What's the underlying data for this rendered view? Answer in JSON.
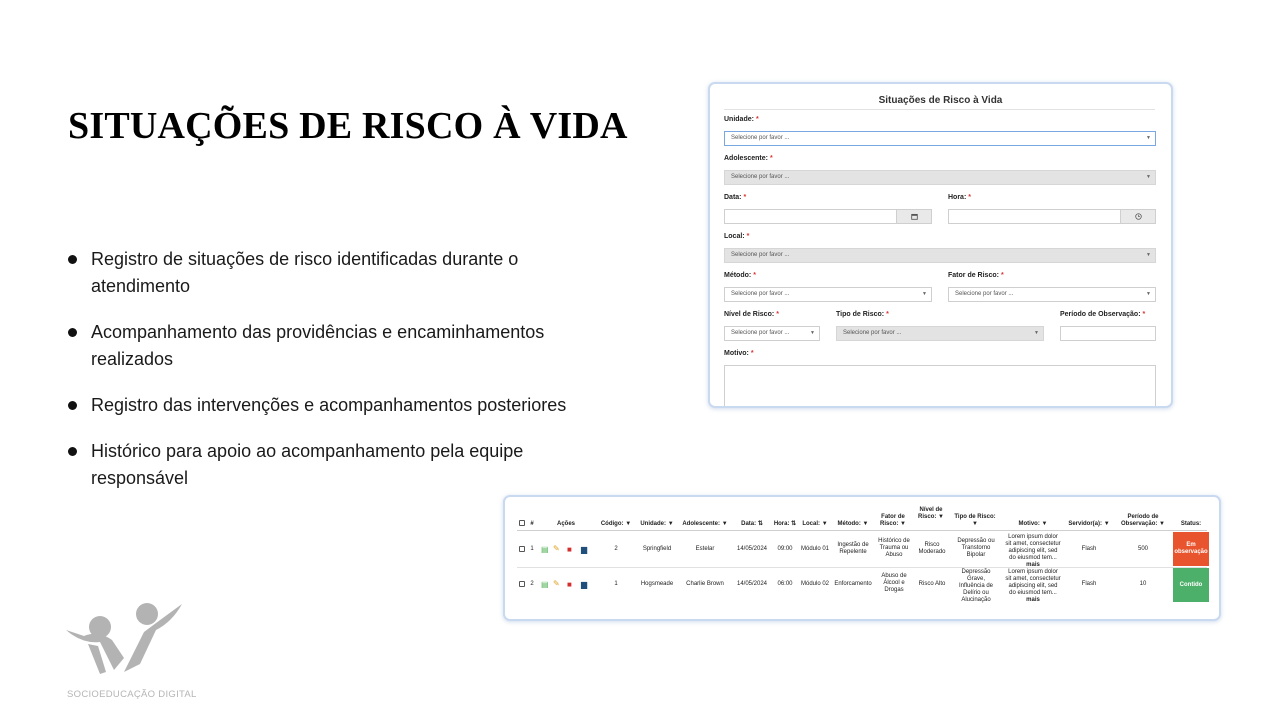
{
  "slide": {
    "title": "SITUAÇÕES DE RISCO À VIDA",
    "bullets": [
      "Registro de situações de risco identificadas durante o atendimento",
      "Acompanhamento das providências e encaminhamentos realizados",
      "Registro das intervenções e acompanhamentos posteriores",
      "Histórico para apoio ao acompanhamento pela equipe responsável"
    ],
    "footer_brand": "SOCIOEDUCAÇÃO DIGITAL"
  },
  "form": {
    "title": "Situações de Risco à Vida",
    "required_mark": "*",
    "placeholder": "Selecione por favor ...",
    "labels": {
      "unidade": "Unidade:",
      "adolescente": "Adolescente:",
      "data": "Data:",
      "hora": "Hora:",
      "local": "Local:",
      "metodo": "Método:",
      "fator_risco": "Fator de Risco:",
      "nivel_risco": "Nível de Risco:",
      "tipo_risco": "Tipo de Risco:",
      "periodo_obs": "Período de Observação:",
      "motivo": "Motivo:"
    }
  },
  "table": {
    "headers": {
      "num": "#",
      "acoes": "Ações",
      "codigo": "Código:",
      "unidade": "Unidade:",
      "adolescente": "Adolescente:",
      "data": "Data:",
      "hora": "Hora:",
      "local": "Local:",
      "metodo": "Método:",
      "fator": "Fator de Risco:",
      "nivel": "Nível de Risco:",
      "tipo": "Tipo de Risco:",
      "motivo": "Motivo:",
      "servidor": "Servidor(a):",
      "periodo": "Período de Observação:",
      "status": "Status:"
    },
    "filter_glyph": "▼",
    "sort_glyph": "⇅",
    "more_label": "mais",
    "rows": [
      {
        "num": "1",
        "codigo": "2",
        "unidade": "Springfield",
        "adolescente": "Estelar",
        "data": "14/05/2024",
        "hora": "09:00",
        "local": "Módulo 01",
        "metodo": "Ingestão de Repelente",
        "fator": "Histórico de Trauma ou Abuso",
        "nivel": "Risco Moderado",
        "tipo": "Depressão ou Transtorno Bipolar",
        "motivo": "Lorem ipsum dolor sit amet, consectetur adipiscing elit, sed do eiusmod tem...",
        "servidor": "Flash",
        "periodo": "500",
        "status": "Em observação",
        "status_color": "#e8542e"
      },
      {
        "num": "2",
        "codigo": "1",
        "unidade": "Hogsmeade",
        "adolescente": "Charlie Brown",
        "data": "14/05/2024",
        "hora": "06:00",
        "local": "Módulo 02",
        "metodo": "Enforcamento",
        "fator": "Abuso de Álcool e Drogas",
        "nivel": "Risco Alto",
        "tipo": "Depressão Grave, Influência de Delírio ou Alucinação",
        "motivo": "Lorem ipsum dolor sit amet, consectetur adipiscing elit, sed do eiusmod tem...",
        "servidor": "Flash",
        "periodo": "10",
        "status": "Contido",
        "status_color": "#4caf6a"
      }
    ]
  },
  "icons": {
    "calendar": "calendar-icon",
    "clock": "clock-icon",
    "view": "document-icon",
    "edit": "pencil-icon",
    "delete": "trash-icon",
    "print": "printer-icon"
  },
  "colors": {
    "card_border": "#c9d9f0",
    "required": "#dd3333",
    "status_observation": "#e8542e",
    "status_contained": "#4caf6a",
    "logo_gray": "#b0b0b0"
  }
}
